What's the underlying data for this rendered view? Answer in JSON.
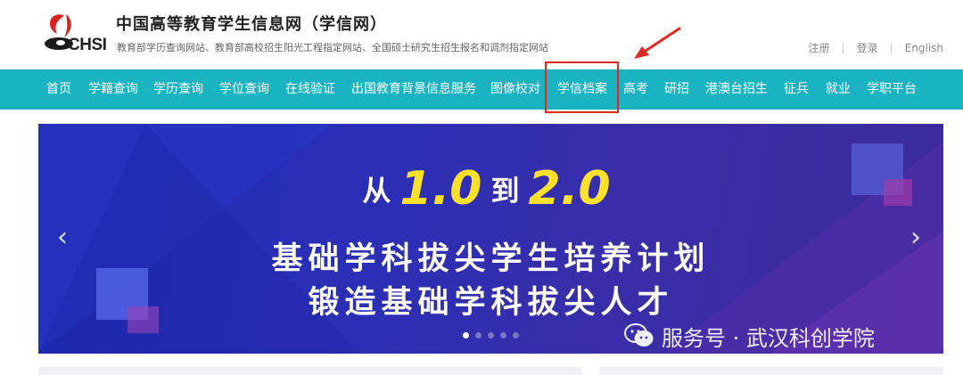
{
  "header": {
    "logo_text": "CHSI",
    "title": "中国高等教育学生信息网（学信网）",
    "subtitle": "教育部学历查询网站、教育部高校招生阳光工程指定网站、全国硕士研究生招生报名和调剂指定网站",
    "links": {
      "register": "注册",
      "login": "登录",
      "english": "English"
    }
  },
  "nav": {
    "items": [
      "首页",
      "学籍查询",
      "学历查询",
      "学位查询",
      "在线验证",
      "出国教育背景信息服务",
      "图像校对",
      "学信档案",
      "高考",
      "研招",
      "港澳台招生",
      "征兵",
      "就业",
      "学职平台"
    ],
    "highlighted": "学信档案"
  },
  "banner": {
    "line1_prefix": "从",
    "line1_num1": "1.0",
    "line1_mid": "到",
    "line1_num2": "2.0",
    "line2": "基础学科拔尖学生培养计划",
    "line3": "锻造基础学科拔尖人才",
    "prev_icon": "‹",
    "next_icon": "›",
    "slide_count": 5,
    "active_slide": 1
  },
  "watermark": {
    "text": "服务号 · 武汉科创学院",
    "icon": "wechat-icon"
  },
  "colors": {
    "nav_bg": "#1ab3c1",
    "highlight": "#e0291f",
    "banner_bg": "#2a2fb6",
    "accent_yellow": "#ffe02a"
  }
}
